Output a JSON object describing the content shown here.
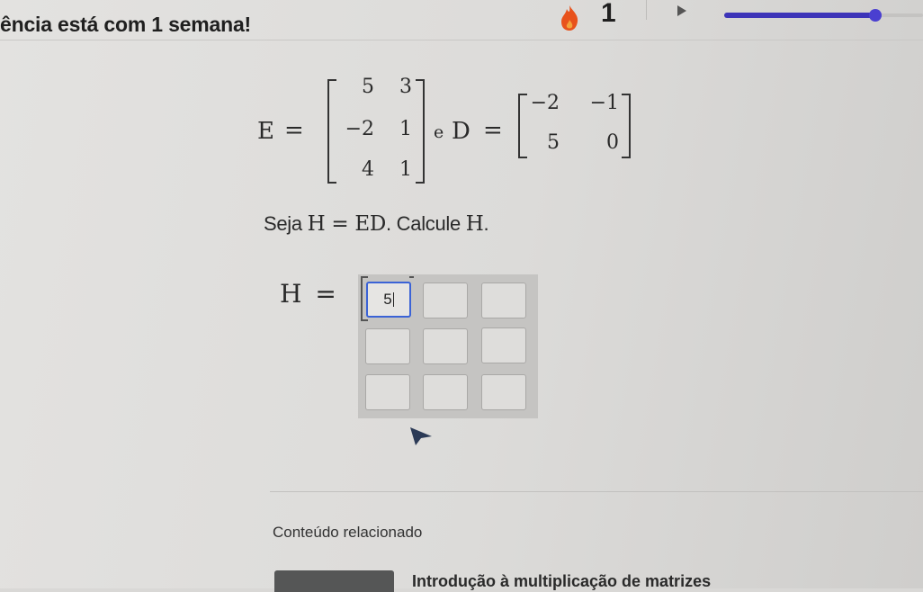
{
  "header": {
    "streak_message": "ência está com 1 semana!",
    "streak_count": "1",
    "icons": {
      "flame": "flame-icon",
      "play": "play-icon"
    },
    "progress": 0.76,
    "colors": {
      "progress": "#3d34b8",
      "flame": "#e8521c"
    }
  },
  "problem": {
    "E_label": "E",
    "equals": "=",
    "E_matrix": [
      [
        "5",
        "3"
      ],
      [
        "−2",
        "1"
      ],
      [
        "4",
        "1"
      ]
    ],
    "conjunction": "e",
    "D_label": "D",
    "D_matrix": [
      [
        "−2",
        "−1"
      ],
      [
        "5",
        "0"
      ]
    ],
    "prompt_pre": "Seja",
    "prompt_math": "H = ED",
    "prompt_mid": ". Calcule",
    "prompt_var": "H",
    "prompt_end": "."
  },
  "answer": {
    "label": "H",
    "equals": "=",
    "cells": [
      [
        "5",
        "",
        ""
      ],
      [
        "",
        "",
        ""
      ],
      [
        "",
        "",
        ""
      ]
    ]
  },
  "related": {
    "heading": "Conteúdo relacionado",
    "link_title": "Introdução à multiplicação de matrizes"
  }
}
